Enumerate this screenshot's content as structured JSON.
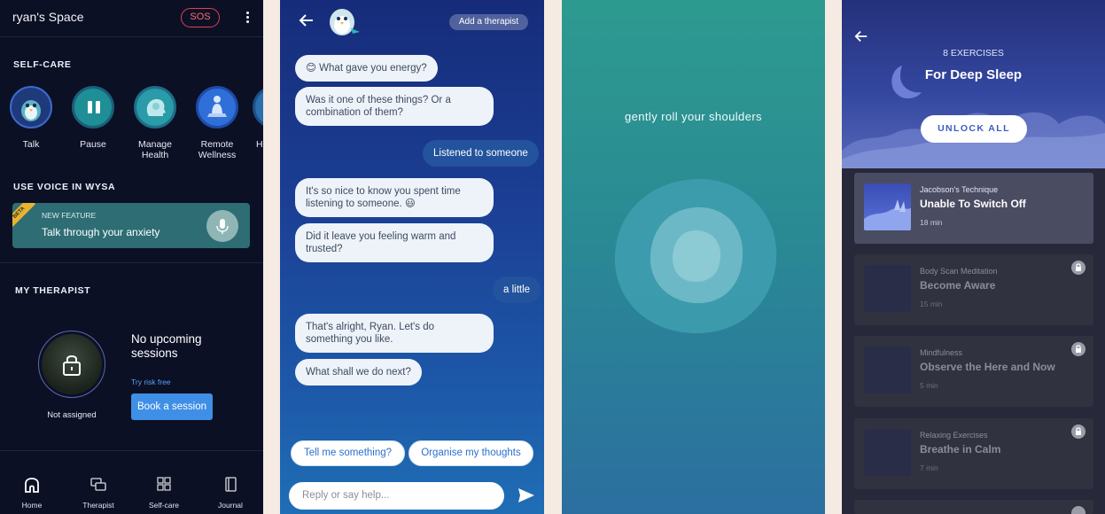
{
  "home": {
    "title": "ryan's Space",
    "sos_label": "SOS",
    "selfcare_heading": "SELF-CARE",
    "selfcare_items": [
      {
        "label": "Talk",
        "icon": "penguin-icon"
      },
      {
        "label": "Pause",
        "icon": "pause-icon"
      },
      {
        "label": "Manage Health",
        "icon": "head-profile-icon"
      },
      {
        "label": "Remote Wellness",
        "icon": "meditation-icon"
      },
      {
        "label": "H",
        "icon": "partial-icon"
      }
    ],
    "voice_heading": "USE VOICE IN WYSA",
    "voice_card": {
      "badge": "BETA",
      "kicker": "NEW FEATURE",
      "text": "Talk through your anxiety"
    },
    "therapist_heading": "MY THERAPIST",
    "therapist": {
      "status": "Not assigned",
      "sessions_text": "No upcoming sessions",
      "trial_link": "Try risk free",
      "book_label": "Book a session"
    },
    "nav": [
      {
        "label": "Home",
        "icon": "home-icon"
      },
      {
        "label": "Therapist",
        "icon": "chat-bubbles-icon"
      },
      {
        "label": "Self-care",
        "icon": "grid-icon"
      },
      {
        "label": "Journal",
        "icon": "journal-icon"
      }
    ]
  },
  "chat": {
    "add_therapist": "Add a therapist",
    "messages": [
      {
        "from": "bot",
        "text": "😊 What gave you energy?"
      },
      {
        "from": "bot",
        "text": "Was it one of these things? Or a combination of them?"
      },
      {
        "from": "user",
        "text": "Listened to someone"
      },
      {
        "from": "bot",
        "text": "It's so nice to know you spent time listening to someone. 😃"
      },
      {
        "from": "bot",
        "text": "Did it leave you feeling warm and trusted?"
      },
      {
        "from": "user",
        "text": "a little"
      },
      {
        "from": "bot",
        "text": "That's alright, Ryan. Let's do something you like."
      },
      {
        "from": "bot",
        "text": "What shall we do next?"
      }
    ],
    "chips": [
      "Tell me something?",
      "Organise my thoughts"
    ],
    "reply_placeholder": "Reply or say help..."
  },
  "breathe": {
    "instruction": "gently roll your shoulders",
    "colors": {
      "top": "#2d9a8f",
      "bottom": "#2b6fa0"
    }
  },
  "sleep": {
    "count": "8 EXERCISES",
    "title": "For Deep Sleep",
    "unlock_label": "UNLOCK ALL",
    "exercises": [
      {
        "category": "Jacobson's Technique",
        "title": "Unable To Switch Off",
        "duration": "18 min",
        "locked": false
      },
      {
        "category": "Body Scan Meditation",
        "title": "Become Aware",
        "duration": "15 min",
        "locked": true
      },
      {
        "category": "Mindfulness",
        "title": "Observe the Here and Now",
        "duration": "5 min",
        "locked": true
      },
      {
        "category": "Relaxing Exercises",
        "title": "Breathe in Calm",
        "duration": "7 min",
        "locked": true
      }
    ]
  }
}
